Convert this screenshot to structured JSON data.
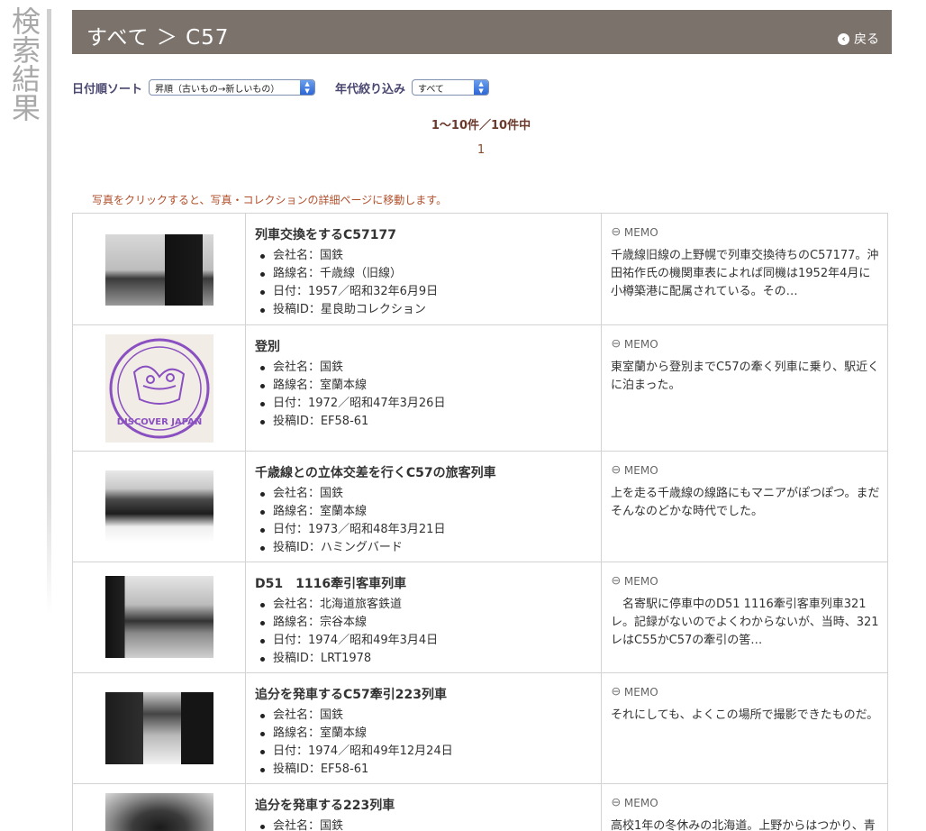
{
  "side_title": [
    "検",
    "索",
    "結",
    "果"
  ],
  "header": {
    "title": "すべて ＞ C57",
    "back_label": "戻る"
  },
  "controls": {
    "sort_label": "日付順ソート",
    "sort_value": "昇順（古いもの→新しいもの）",
    "era_label": "年代絞り込み",
    "era_value": "すべて"
  },
  "count_text": "1〜10件／10件中",
  "page_number": "1",
  "notice": "写真をクリックすると、写真・コレクションの詳細ページに移動します。",
  "memo_label": "MEMO",
  "results": [
    {
      "title": "列車交換をするC57177",
      "company": "会社名：国鉄",
      "line": "路線名：千歳線（旧線）",
      "date": "日付：1957／昭和32年6月9日",
      "poster": "投稿ID：星良助コレクション",
      "memo": "千歳線旧線の上野幌で列車交換待ちのC57177。沖田祐作氏の機関車表によれば同機は1952年4月に小樽築港に配属されている。その…"
    },
    {
      "title": "登別",
      "company": "会社名：国鉄",
      "line": "路線名：室蘭本線",
      "date": "日付：1972／昭和47年3月26日",
      "poster": "投稿ID：EF58-61",
      "memo": "東室蘭から登別までC57の牽く列車に乗り、駅近くに泊まった。"
    },
    {
      "title": "千歳線との立体交差を行くC57の旅客列車",
      "company": "会社名：国鉄",
      "line": "路線名：室蘭本線",
      "date": "日付：1973／昭和48年3月21日",
      "poster": "投稿ID：ハミングバード",
      "memo": "上を走る千歳線の線路にもマニアがぽつぽつ。まだそんなのどかな時代でした。"
    },
    {
      "title": "D51　1116牽引客車列車",
      "company": "会社名：北海道旅客鉄道",
      "line": "路線名：宗谷本線",
      "date": "日付：1974／昭和49年3月4日",
      "poster": "投稿ID：LRT1978",
      "memo": "　名寄駅に停車中のD51 1116牽引客車列車321レ。記録がないのでよくわからないが、当時、321レはC55かC57の牽引の筈…"
    },
    {
      "title": "追分を発車するC57牽引223列車",
      "company": "会社名：国鉄",
      "line": "路線名：室蘭本線",
      "date": "日付：1974／昭和49年12月24日",
      "poster": "投稿ID：EF58-61",
      "memo": "それにしても、よくこの場所で撮影できたものだ。"
    },
    {
      "title": "追分を発車する223列車",
      "company": "会社名：国鉄",
      "memo": "高校1年の冬休みの北海道。上野からはつかり、青"
    }
  ],
  "stamp_text": "DISCOVER JAPAN",
  "colors": {
    "header_bg": "#7a726b",
    "accent_text": "#6b3a2c",
    "notice": "#b2502c",
    "stamp": "#8a4fc0"
  }
}
